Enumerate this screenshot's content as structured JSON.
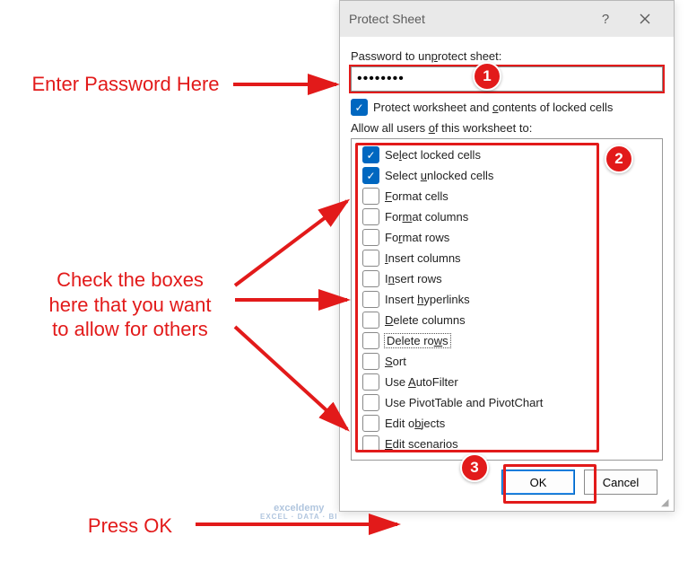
{
  "annotations": {
    "a1": "Enter Password Here",
    "a2": "Check the boxes\nhere that you want\nto allow for others",
    "a3": "Press OK"
  },
  "dialog": {
    "title": "Protect Sheet",
    "password_label": "Password to unprotect sheet:",
    "password_value": "••••••••",
    "protect_label": "Protect worksheet and contents of locked cells",
    "allow_label": "Allow all users of this worksheet to:",
    "permissions": [
      {
        "label": "Select locked cells",
        "checked": true,
        "ul": "l"
      },
      {
        "label": "Select unlocked cells",
        "checked": true,
        "ul": "u"
      },
      {
        "label": "Format cells",
        "checked": false,
        "ul": "F"
      },
      {
        "label": "Format columns",
        "checked": false,
        "ul": "m"
      },
      {
        "label": "Format rows",
        "checked": false,
        "ul": "r"
      },
      {
        "label": "Insert columns",
        "checked": false,
        "ul": "I"
      },
      {
        "label": "Insert rows",
        "checked": false,
        "ul": "n"
      },
      {
        "label": "Insert hyperlinks",
        "checked": false,
        "ul": "h"
      },
      {
        "label": "Delete columns",
        "checked": false,
        "ul": "D"
      },
      {
        "label": "Delete rows",
        "checked": false,
        "ul": "w",
        "dotted": true
      },
      {
        "label": "Sort",
        "checked": false,
        "ul": "S"
      },
      {
        "label": "Use AutoFilter",
        "checked": false,
        "ul": "A"
      },
      {
        "label": "Use PivotTable and PivotChart",
        "checked": false,
        "ul": "V"
      },
      {
        "label": "Edit objects",
        "checked": false,
        "ul": "b"
      },
      {
        "label": "Edit scenarios",
        "checked": false,
        "ul": "E"
      }
    ],
    "ok": "OK",
    "cancel": "Cancel"
  },
  "callouts": {
    "c1": "1",
    "c2": "2",
    "c3": "3"
  },
  "watermark": {
    "main": "exceldemy",
    "sub": "EXCEL · DATA · BI"
  }
}
